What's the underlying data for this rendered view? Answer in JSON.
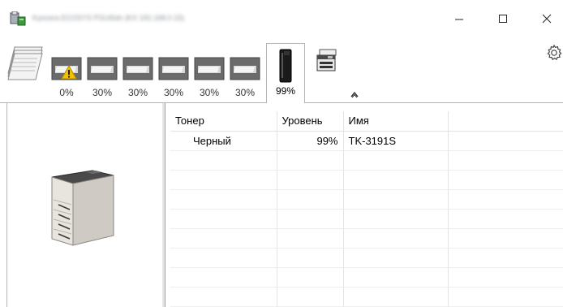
{
  "window": {
    "title": "Kyocera ECOSYS P3145dn (KX 192.168.0.15)"
  },
  "toolbar": {
    "trays": [
      {
        "id": "tray-1",
        "level": "0%",
        "warning": true
      },
      {
        "id": "tray-2",
        "level": "30%"
      },
      {
        "id": "tray-3",
        "level": "30%"
      },
      {
        "id": "tray-4",
        "level": "30%"
      },
      {
        "id": "tray-5",
        "level": "30%"
      },
      {
        "id": "tray-6",
        "level": "30%"
      }
    ],
    "toner_tab_level": "99%"
  },
  "table": {
    "headers": [
      "Тонер",
      "Уровень",
      "Имя",
      ""
    ],
    "rows": [
      {
        "toner": "Черный",
        "level": "99%",
        "name": "TK-3191S"
      }
    ]
  },
  "icons": {
    "app": "printer-status-icon",
    "tray_stack": "paper-stack-icon",
    "tray": "paper-tray-icon",
    "warning": "warning-icon",
    "toner": "toner-cartridge-icon",
    "mfp": "multifunction-printer-icon",
    "collapse": "chevron-up-icon",
    "gear": "gear-icon",
    "printer": "printer-icon"
  },
  "colors": {
    "border": "#b5b5b5",
    "warning": "#f2c200",
    "title_blur": "#8a8f96"
  }
}
